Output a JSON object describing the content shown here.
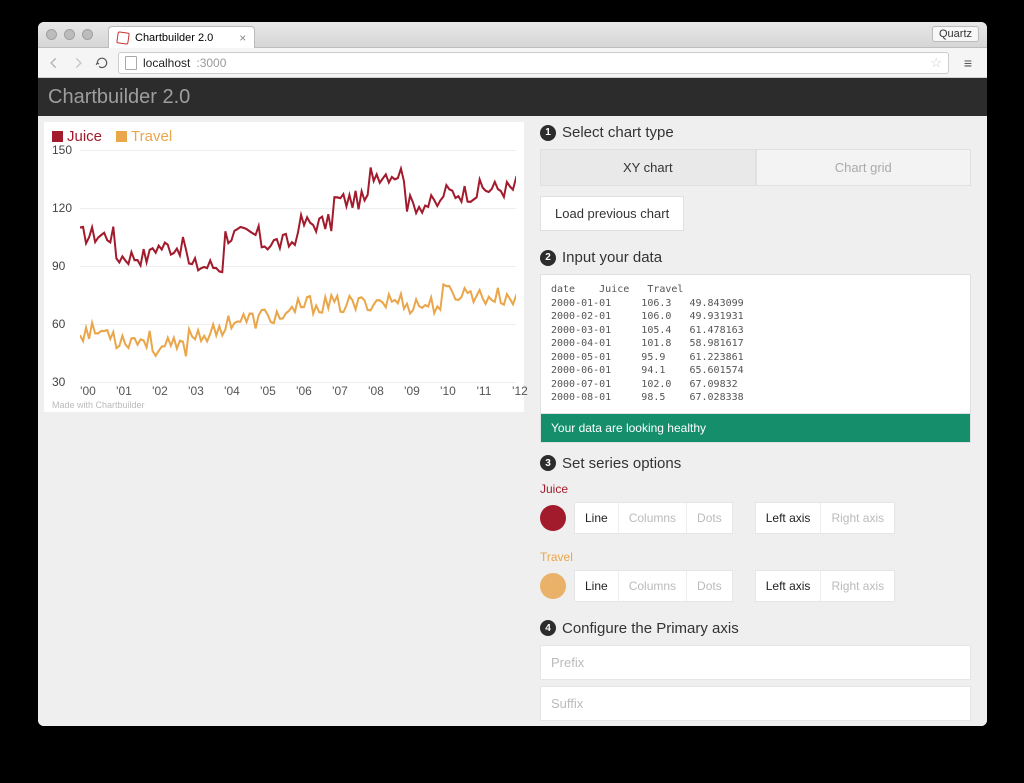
{
  "browser": {
    "tab_title": "Chartbuilder 2.0",
    "quartz": "Quartz",
    "url_host": "localhost",
    "url_port": ":3000"
  },
  "app": {
    "title": "Chartbuilder 2.0"
  },
  "chart": {
    "legend": {
      "juice": "Juice",
      "travel": "Travel"
    },
    "made_with": "Made with Chartbuilder",
    "yticks": [
      "150",
      "120",
      "90",
      "60",
      "30"
    ],
    "xticks": [
      "'00",
      "'01",
      "'02",
      "'03",
      "'04",
      "'05",
      "'06",
      "'07",
      "'08",
      "'09",
      "'10",
      "'11",
      "'12"
    ]
  },
  "chart_data": {
    "type": "line",
    "xlabel": "",
    "ylabel": "",
    "ylim": [
      30,
      150
    ],
    "x": [
      "2000",
      "2001",
      "2002",
      "2003",
      "2004",
      "2005",
      "2006",
      "2007",
      "2008",
      "2009",
      "2010",
      "2011",
      "2012"
    ],
    "series": [
      {
        "name": "Juice",
        "color": "#a21b2d",
        "values": [
          106,
          95,
          100,
          90,
          106,
          102,
          112,
          124,
          138,
          122,
          128,
          130,
          132
        ]
      },
      {
        "name": "Travel",
        "color": "#eaa64a",
        "values": [
          56,
          52,
          48,
          55,
          62,
          64,
          70,
          70,
          72,
          70,
          76,
          74,
          70
        ]
      }
    ]
  },
  "steps": {
    "s1": "Select chart type",
    "s2": "Input your data",
    "s3": "Set series options",
    "s4": "Configure the Primary axis"
  },
  "chart_type": {
    "xy": "XY chart",
    "grid": "Chart grid"
  },
  "load_previous": "Load previous chart",
  "data_text": "date    Juice   Travel\n2000-01-01     106.3   49.843099\n2000-02-01     106.0   49.931931\n2000-03-01     105.4   61.478163\n2000-04-01     101.8   58.981617\n2000-05-01     95.9    61.223861\n2000-06-01     94.1    65.601574\n2000-07-01     102.0   67.09832\n2000-08-01     98.5    67.028338",
  "status_ok": "Your data are looking healthy",
  "series": {
    "juice": "Juice",
    "travel": "Travel",
    "opts": {
      "line": "Line",
      "columns": "Columns",
      "dots": "Dots",
      "left": "Left axis",
      "right": "Right axis"
    }
  },
  "cfg": {
    "prefix_ph": "Prefix",
    "suffix_ph": "Suffix"
  }
}
